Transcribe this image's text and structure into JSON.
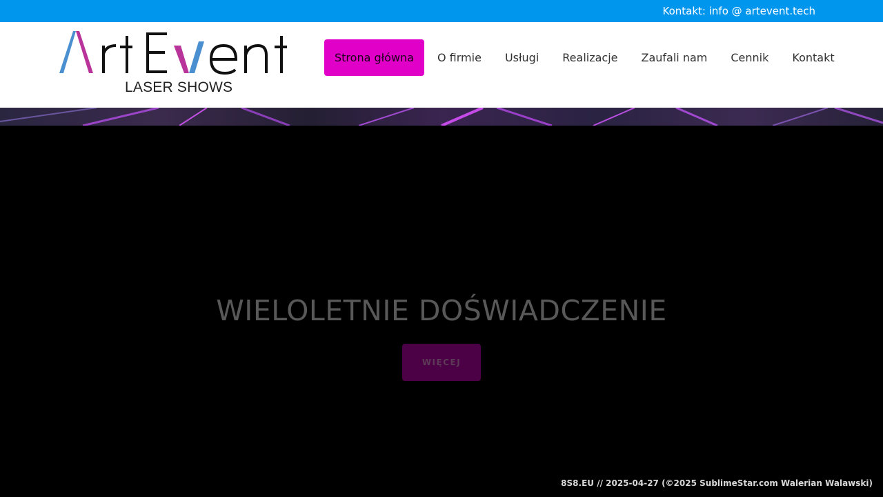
{
  "topbar": {
    "contact": "Kontakt: info @ artevent.tech"
  },
  "logo": {
    "wordmark": "ArtEvent",
    "tagline": "LASER SHOWS"
  },
  "nav": {
    "items": [
      {
        "label": "Strona główna",
        "active": true
      },
      {
        "label": "O firmie"
      },
      {
        "label": "Usługi"
      },
      {
        "label": "Realizacje"
      },
      {
        "label": "Zaufali nam"
      },
      {
        "label": "Cennik"
      },
      {
        "label": "Kontakt"
      }
    ]
  },
  "hero": {
    "heading": "WIELOLETNIE DOŚWIADCZENIE",
    "button_label": "WIĘCEJ"
  },
  "footer_note": "8S8.EU // 2025-04-27 (©2025 SublimeStar.com Walerian Walawski)",
  "colors": {
    "topbar": "#0096ee",
    "active_nav": "#e100c8",
    "logo_blue": "#4a8fd0",
    "logo_magenta": "#b8349a",
    "hero_button": "#4c0045"
  }
}
